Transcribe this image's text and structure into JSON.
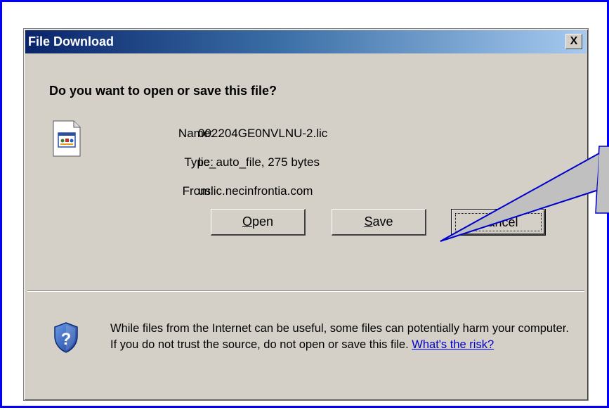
{
  "dialog": {
    "title": "File Download",
    "close_label": "X",
    "question": "Do you want to open or save this file?",
    "file_icon": "file-document-icon",
    "fields": [
      {
        "label": "Name:",
        "value": "002204GE0NVLNU-2.lic"
      },
      {
        "label": "Type:",
        "value": "lic_auto_file, 275 bytes"
      },
      {
        "label": "From:",
        "value": "uslic.necinfrontia.com"
      }
    ],
    "buttons": {
      "open": {
        "mnemonic": "O",
        "rest": "pen"
      },
      "save": {
        "mnemonic": "S",
        "rest": "ave"
      },
      "cancel": "Cancel"
    },
    "warning_icon": "shield-question-icon",
    "warning_text": "While files from the Internet can be useful, some files can potentially harm your computer. If you do not trust the source, do not open or save this file.",
    "risk_link": "What's the risk?"
  },
  "colors": {
    "frame_border": "#0000ff",
    "dialog_bg": "#d4d0c8",
    "titlebar_start": "#0a246a",
    "titlebar_end": "#a6caf0",
    "callout_fill": "#c0c0c0",
    "link": "#0000cc"
  }
}
